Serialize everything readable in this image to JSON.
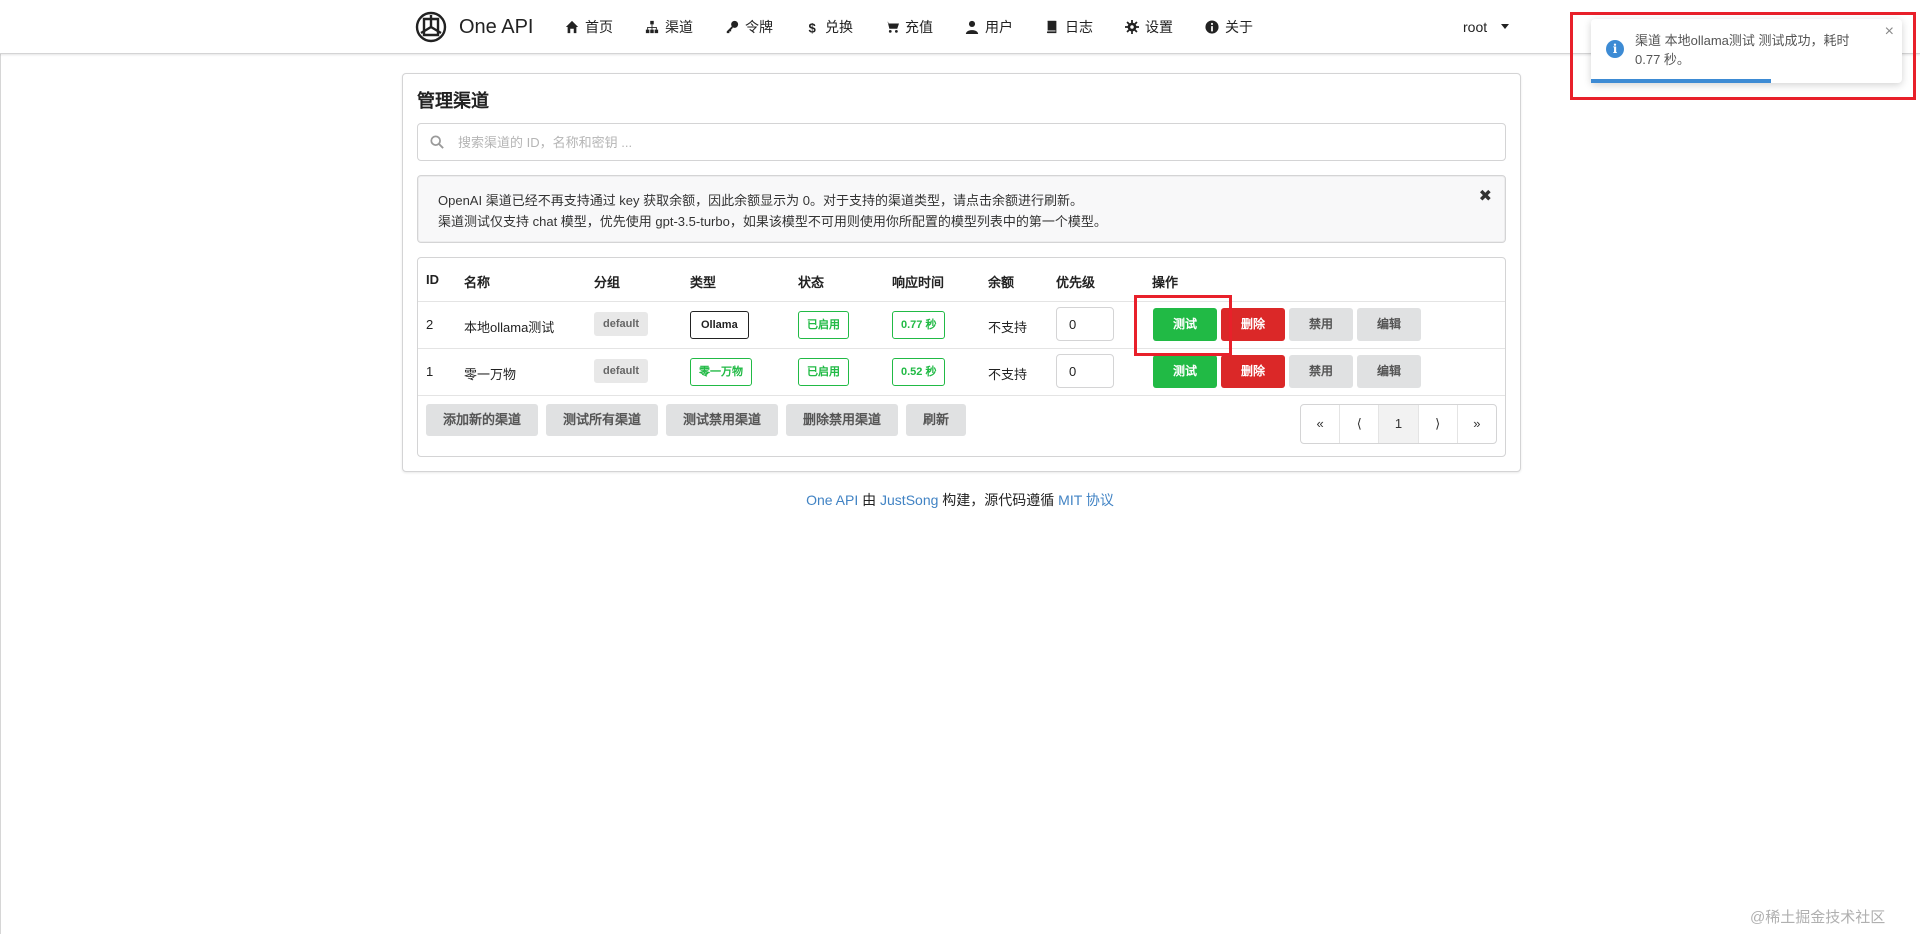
{
  "app": {
    "name": "One API",
    "user": "root"
  },
  "nav": [
    {
      "label": "首页",
      "icon": "home-icon"
    },
    {
      "label": "渠道",
      "icon": "sitemap-icon"
    },
    {
      "label": "令牌",
      "icon": "key-icon"
    },
    {
      "label": "兑换",
      "icon": "dollar-icon"
    },
    {
      "label": "充值",
      "icon": "cart-icon"
    },
    {
      "label": "用户",
      "icon": "user-icon"
    },
    {
      "label": "日志",
      "icon": "book-icon"
    },
    {
      "label": "设置",
      "icon": "gear-icon"
    },
    {
      "label": "关于",
      "icon": "info-icon"
    }
  ],
  "page": {
    "title": "管理渠道",
    "search_placeholder": "搜索渠道的 ID，名称和密钥 ...",
    "notice": [
      "OpenAI 渠道已经不再支持通过 key 获取余额，因此余额显示为 0。对于支持的渠道类型，请点击余额进行刷新。",
      "渠道测试仅支持 chat 模型，优先使用 gpt-3.5-turbo，如果该模型不可用则使用你所配置的模型列表中的第一个模型。"
    ],
    "notice_close": "✖"
  },
  "table": {
    "headers": [
      "ID",
      "名称",
      "分组",
      "类型",
      "状态",
      "响应时间",
      "余额",
      "优先级",
      "操作"
    ],
    "rows": [
      {
        "id": "2",
        "name": "本地ollama测试",
        "group": "default",
        "type": "Ollama",
        "status": "已启用",
        "response": "0.77 秒",
        "balance": "不支持",
        "priority": "0"
      },
      {
        "id": "1",
        "name": "零一万物",
        "group": "default",
        "type": "零一万物",
        "status": "已启用",
        "response": "0.52 秒",
        "balance": "不支持",
        "priority": "0"
      }
    ],
    "row_actions": {
      "test": "测试",
      "delete": "删除",
      "disable": "禁用",
      "edit": "编辑"
    },
    "footer_buttons": [
      "添加新的渠道",
      "测试所有渠道",
      "测试禁用渠道",
      "删除禁用渠道",
      "刷新"
    ],
    "pagination": [
      "«",
      "⟨",
      "1",
      "⟩",
      "»"
    ]
  },
  "footer": {
    "app_link": "One API",
    "by": " 由 ",
    "author_link": "JustSong",
    "mid": " 构建，源代码遵循 ",
    "license_link": "MIT 协议"
  },
  "toast": {
    "message": "渠道 本地ollama测试 测试成功，耗时 0.77 秒。",
    "close": "×",
    "icon": "info-icon",
    "progress": 0.58
  },
  "watermark": "@稀土掘金技术社区",
  "colors": {
    "green": "#21ba45",
    "red": "#db2828",
    "link": "#4183c4",
    "highlight": "#e8202a",
    "toast_accent": "#3d8bd4"
  }
}
